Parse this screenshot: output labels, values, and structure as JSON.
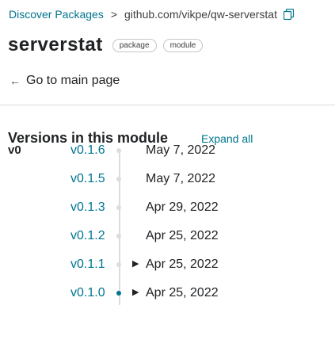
{
  "breadcrumb": {
    "root": "Discover Packages",
    "separator": ">",
    "current": "github.com/vikpe/qw-serverstat"
  },
  "header": {
    "title": "serverstat",
    "badges": [
      "package",
      "module"
    ]
  },
  "nav": {
    "back_arrow": "←",
    "back_label": "Go to main page"
  },
  "versions_section": {
    "title": "Versions in this module",
    "expand_all": "Expand all",
    "major": "v0",
    "versions": [
      {
        "version": "v0.1.6",
        "date": "May 7, 2022",
        "expandable": false,
        "expander": ""
      },
      {
        "version": "v0.1.5",
        "date": "May 7, 2022",
        "expandable": false,
        "expander": ""
      },
      {
        "version": "v0.1.3",
        "date": "Apr 29, 2022",
        "expandable": false,
        "expander": ""
      },
      {
        "version": "v0.1.2",
        "date": "Apr 25, 2022",
        "expandable": false,
        "expander": ""
      },
      {
        "version": "v0.1.1",
        "date": "Apr 25, 2022",
        "expandable": true,
        "expander": "▶"
      },
      {
        "version": "v0.1.0",
        "date": "Apr 25, 2022",
        "expandable": true,
        "expander": "▶"
      }
    ]
  },
  "colors": {
    "link": "#00758f",
    "text": "#202224",
    "timeline": "#dadce0"
  },
  "icons": {
    "copy": "copy-icon",
    "back": "arrow-left-icon",
    "expand": "caret-right-icon"
  }
}
